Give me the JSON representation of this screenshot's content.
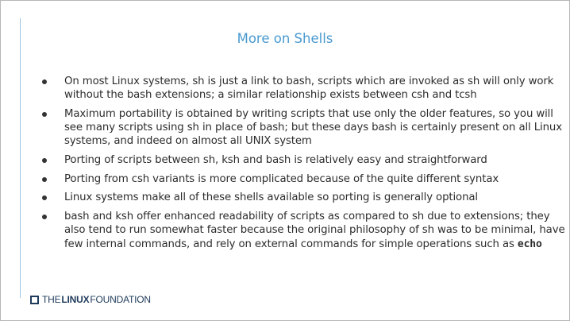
{
  "slide": {
    "title": "More on Shells",
    "bullets": [
      {
        "text": "On most Linux systems, sh is just a link to bash, scripts which are invoked as sh will only work without the bash extensions; a similar relationship exists between csh and tcsh"
      },
      {
        "text": "Maximum portability is obtained by writing scripts that use only the older features, so you will see many scripts using sh in place of bash; but these days bash is certainly present on all Linux systems, and indeed on almost all UNIX system"
      },
      {
        "text": "Porting of scripts between sh, ksh and bash is relatively easy and straightforward"
      },
      {
        "text": "Porting from csh variants is more complicated because of the quite different syntax"
      },
      {
        "text": "Linux systems make all of these shells available so porting is generally optional"
      },
      {
        "text": "bash and ksh offer enhanced readability of scripts as compared to sh due to extensions; they also tend to run somewhat faster because the original philosophy of sh was to be minimal, have few internal commands, and rely on external commands for simple operations such as ",
        "code": "echo"
      }
    ]
  },
  "footer": {
    "logo_icon": "square-outline-icon",
    "logo_the": "THE",
    "logo_linux": "LINUX",
    "logo_foundation": "FOUNDATION"
  },
  "colors": {
    "title": "#4a9ad0",
    "body_text": "#2d2d2d",
    "accent_rule": "#9fc3e0",
    "logo": "#1f3b5c"
  }
}
